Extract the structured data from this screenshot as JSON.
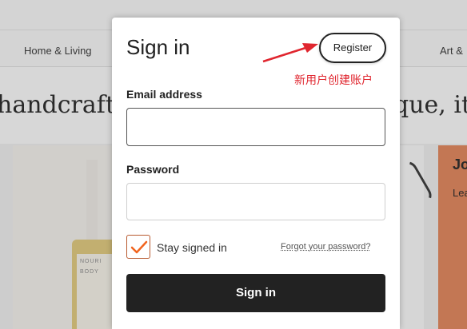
{
  "background": {
    "nav": {
      "home_living": "Home & Living",
      "art": "Art &"
    },
    "hero": {
      "left_text": "handcrafte",
      "right_text": "que, it'"
    },
    "promo": {
      "title": "Jo",
      "subtitle": "Lea"
    }
  },
  "modal": {
    "title": "Sign in",
    "register_label": "Register",
    "email_label": "Email address",
    "email_value": "",
    "password_label": "Password",
    "password_value": "",
    "stay_signed_in_label": "Stay signed in",
    "stay_signed_in_checked": true,
    "forgot_password_label": "Forgot your password?",
    "submit_label": "Sign in"
  },
  "annotation": {
    "text": "新用户创建账户",
    "color": "#e0262f"
  },
  "colors": {
    "accent": "#f1641e",
    "button": "#222222"
  },
  "icons": {
    "checkbox": "checkmark-icon",
    "annotation": "arrow-icon"
  }
}
